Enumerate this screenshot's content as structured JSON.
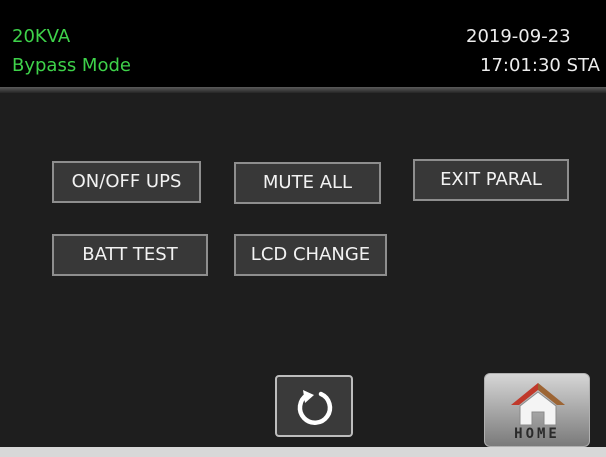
{
  "header": {
    "model": "20KVA",
    "mode": "Bypass Mode",
    "date": "2019-09-23",
    "time": "17:01:30 STA"
  },
  "buttons": {
    "on_off_ups": "ON/OFF UPS",
    "mute_all": "MUTE ALL",
    "exit_paral": "EXIT PARAL",
    "batt_test": "BATT TEST",
    "lcd_change": "LCD CHANGE"
  },
  "nav": {
    "home_label": "HOME",
    "refresh_icon": "refresh-icon",
    "home_icon": "home-icon"
  },
  "colors": {
    "status_green": "#3ed24a",
    "background": "#1e1e1e",
    "button_border": "#8e8e8e",
    "home_roof_red": "#c0392b"
  }
}
